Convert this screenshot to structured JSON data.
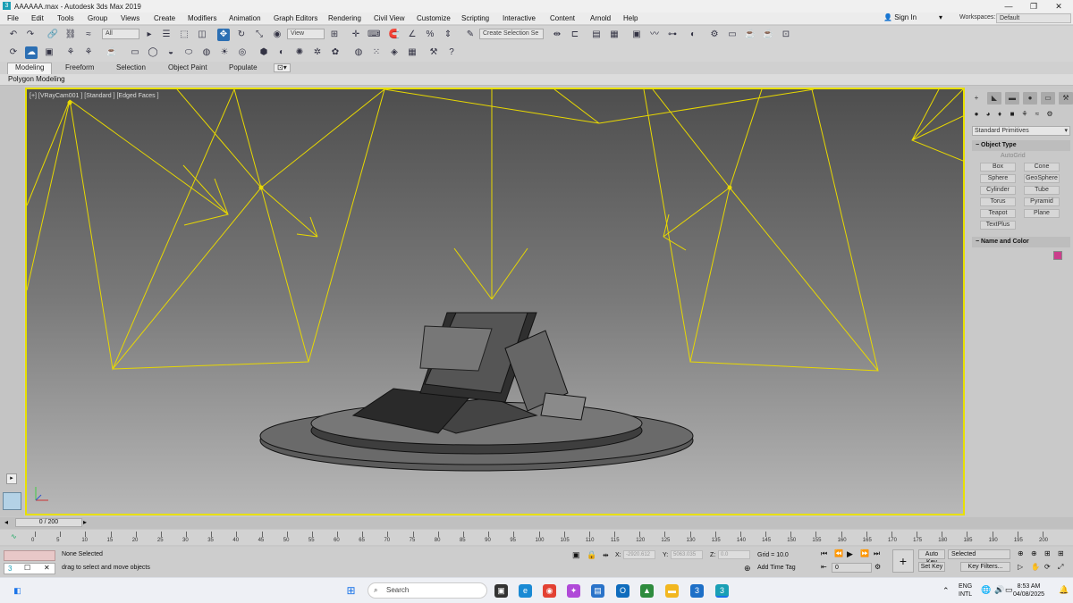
{
  "window": {
    "title": "AAAAAA.max - Autodesk 3ds Max 2019",
    "minimize": "—",
    "maximize": "❐",
    "close": "✕"
  },
  "menubar": {
    "items": [
      "File",
      "Edit",
      "Tools",
      "Group",
      "Views",
      "Create",
      "Modifiers",
      "Animation",
      "Graph Editors",
      "Rendering",
      "Civil View",
      "Customize",
      "Scripting",
      "Interactive",
      "Content",
      "Arnold",
      "Help"
    ],
    "sign_in": "Sign In",
    "workspaces_label": "Workspaces:",
    "workspaces_value": "Default"
  },
  "toolbar": {
    "selection_filter": "All",
    "ref_coord": "View",
    "named_selection": "Create Selection Se"
  },
  "ribbon": {
    "tabs": [
      "Modeling",
      "Freeform",
      "Selection",
      "Object Paint",
      "Populate"
    ],
    "active_tab": "Modeling",
    "sub_label": "Polygon Modeling"
  },
  "viewport": {
    "label": "[+] [VRayCam001 ] [Standard ] [Edged Faces ]",
    "border_color": "#e8e000"
  },
  "command_panel": {
    "category": "Standard Primitives",
    "object_type_title": "Object Type",
    "autogrid": "AutoGrid",
    "buttons": [
      "Box",
      "Cone",
      "Sphere",
      "GeoSphere",
      "Cylinder",
      "Tube",
      "Torus",
      "Pyramid",
      "Teapot",
      "Plane",
      "TextPlus"
    ],
    "name_color_title": "Name and Color",
    "object_color": "#cc3d8c"
  },
  "timeline": {
    "slider": "0 / 200",
    "ticks": [
      "0",
      "5",
      "10",
      "15",
      "20",
      "25",
      "30",
      "35",
      "40",
      "45",
      "50",
      "55",
      "60",
      "65",
      "70",
      "75",
      "80",
      "85",
      "90",
      "95",
      "100",
      "105",
      "110",
      "115",
      "120",
      "125",
      "130",
      "135",
      "140",
      "145",
      "150",
      "155",
      "160",
      "165",
      "170",
      "175",
      "180",
      "185",
      "190",
      "195",
      "200"
    ]
  },
  "status": {
    "selection": "None Selected",
    "hint": "drag to select and move objects",
    "x_label": "X:",
    "x_value": "-2920.612",
    "y_label": "Y:",
    "y_value": "5063.035",
    "z_label": "Z:",
    "z_value": "0.0",
    "grid": "Grid = 10.0",
    "add_time_tag": "Add Time Tag",
    "auto_key": "Auto Key",
    "set_key": "Set Key",
    "selected": "Selected",
    "key_filters": "Key Filters...",
    "frame": "0"
  },
  "taskbar": {
    "search": "Search",
    "lang_top": "ENG",
    "lang_bottom": "INTL",
    "time": "8:53 AM",
    "date": "04/08/2025"
  }
}
